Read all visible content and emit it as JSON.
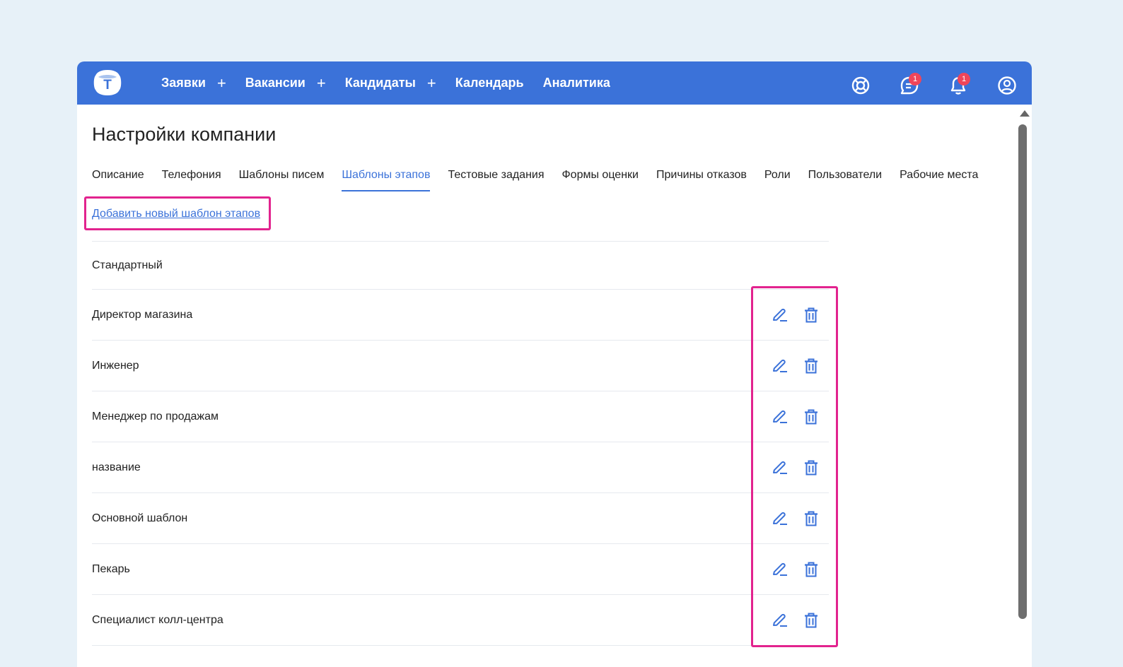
{
  "app": {
    "logo_letter": "T"
  },
  "nav": {
    "items": [
      {
        "label": "Заявки",
        "plus": "+"
      },
      {
        "label": "Вакансии",
        "plus": "+"
      },
      {
        "label": "Кандидаты",
        "plus": "+"
      },
      {
        "label": "Календарь",
        "plus": ""
      },
      {
        "label": "Аналитика",
        "plus": ""
      }
    ]
  },
  "header_icons": {
    "support": "lifebuoy-icon",
    "messages": {
      "icon": "chat-icon",
      "badge": "1"
    },
    "notifications": {
      "icon": "bell-icon",
      "badge": "1"
    },
    "profile": "user-icon"
  },
  "page": {
    "title": "Настройки компании"
  },
  "tabs": [
    {
      "label": "Описание"
    },
    {
      "label": "Телефония"
    },
    {
      "label": "Шаблоны писем"
    },
    {
      "label": "Шаблоны этапов",
      "active": true
    },
    {
      "label": "Тестовые задания"
    },
    {
      "label": "Формы оценки"
    },
    {
      "label": "Причины отказов"
    },
    {
      "label": "Роли"
    },
    {
      "label": "Пользователи"
    },
    {
      "label": "Рабочие места"
    }
  ],
  "add_link": "Добавить новый шаблон этапов",
  "templates": [
    {
      "name": "Стандартный",
      "editable": false
    },
    {
      "name": "Директор магазина",
      "editable": true
    },
    {
      "name": "Инженер",
      "editable": true
    },
    {
      "name": "Менеджер по продажам",
      "editable": true
    },
    {
      "name": "название",
      "editable": true
    },
    {
      "name": "Основной шаблон",
      "editable": true
    },
    {
      "name": "Пекарь",
      "editable": true
    },
    {
      "name": "Специалист колл-центра",
      "editable": true
    }
  ],
  "colors": {
    "accent": "#3b72d9",
    "highlight": "#e2238e",
    "badge": "#f0455a",
    "background": "#e7f1f8"
  }
}
